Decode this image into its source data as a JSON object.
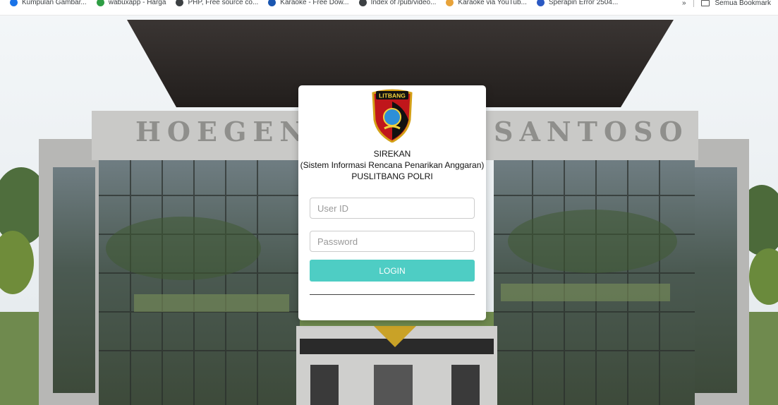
{
  "bookmarks": [
    {
      "label": "Kumpulan Gambar...",
      "color": "#1a73e8"
    },
    {
      "label": "wabuxapp - Harga",
      "color": "#2e9e44"
    },
    {
      "label": "PHP, Free source co...",
      "color": "#3c4043"
    },
    {
      "label": "Karaoke - Free Dow...",
      "color": "#1a56b0"
    },
    {
      "label": "Index of /pub/video...",
      "color": "#3c4043"
    },
    {
      "label": "Karaoke via YouTub...",
      "color": "#e8a33a"
    },
    {
      "label": "Sperapin Error 2504...",
      "color": "#2b59c3"
    }
  ],
  "bookmarks_more": "»",
  "bookmarks_folder": "Semua Bookmark",
  "building": {
    "sign_left": "HOEGENG",
    "sign_right": "SANTOSO"
  },
  "logo": {
    "text": "LITBANG"
  },
  "login": {
    "title": "SIREKAN",
    "subtitle": "(Sistem Informasi Rencana Penarikan Anggaran)",
    "org": "PUSLITBANG POLRI",
    "user_placeholder": "User ID",
    "password_placeholder": "Password",
    "button_label": "LOGIN"
  },
  "colors": {
    "accent": "#4ecdc4",
    "card_bg": "#ffffff"
  }
}
